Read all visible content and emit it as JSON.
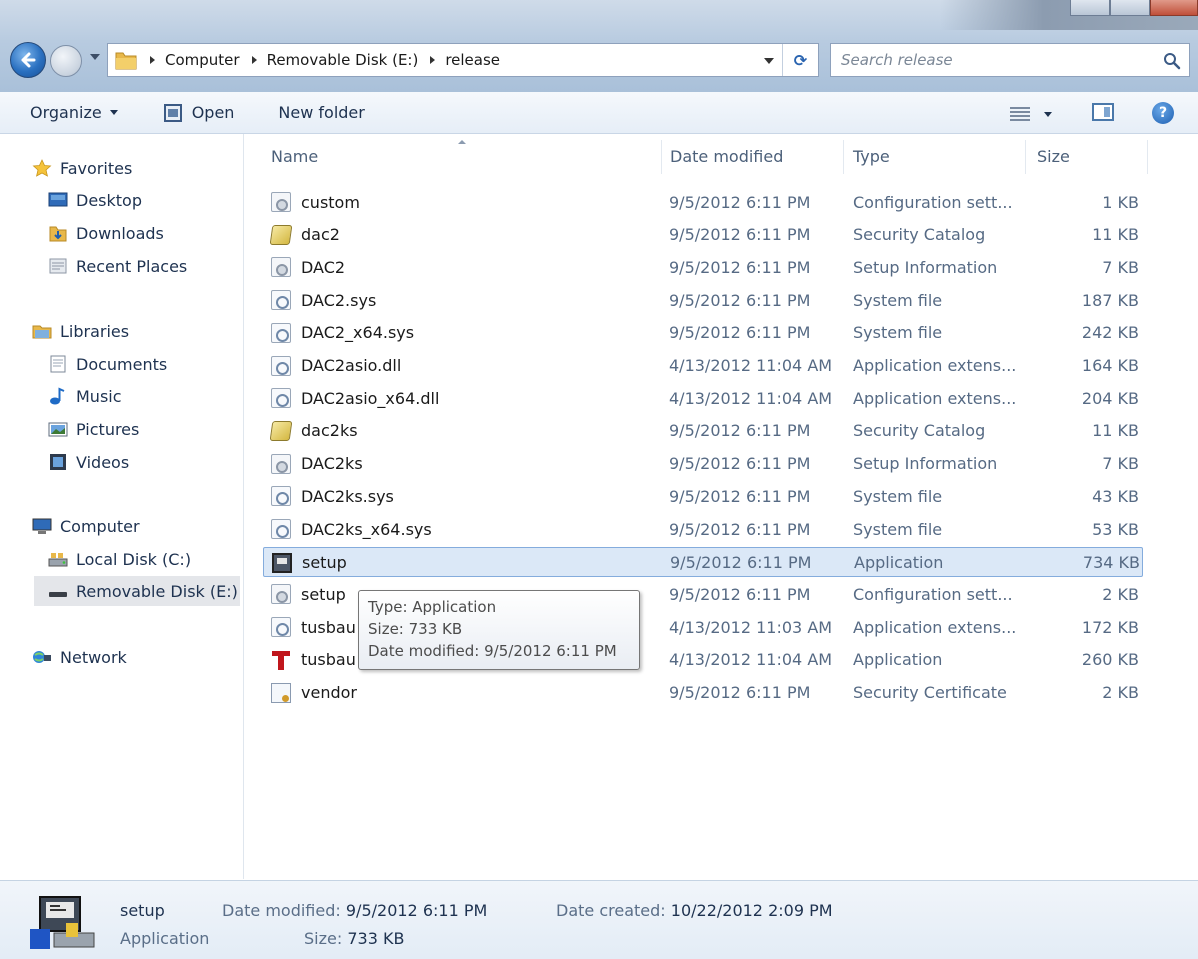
{
  "window": {
    "breadcrumb": [
      "Computer",
      "Removable Disk (E:)",
      "release"
    ],
    "search_placeholder": "Search release"
  },
  "toolbar": {
    "organize_label": "Organize",
    "open_label": "Open",
    "new_folder_label": "New folder"
  },
  "nav": {
    "favorites": "Favorites",
    "desktop": "Desktop",
    "downloads": "Downloads",
    "recent_places": "Recent Places",
    "libraries": "Libraries",
    "documents": "Documents",
    "music": "Music",
    "pictures": "Pictures",
    "videos": "Videos",
    "computer": "Computer",
    "local_disk": "Local Disk (C:)",
    "removable_disk": "Removable Disk (E:)",
    "network": "Network"
  },
  "columns": {
    "name": "Name",
    "date": "Date modified",
    "type": "Type",
    "size": "Size"
  },
  "files": [
    {
      "name": "custom",
      "date": "9/5/2012 6:11 PM",
      "type": "Configuration sett...",
      "size": "1 KB",
      "icon": "config-icon"
    },
    {
      "name": "dac2",
      "date": "9/5/2012 6:11 PM",
      "type": "Security Catalog",
      "size": "11 KB",
      "icon": "catalog-icon"
    },
    {
      "name": "DAC2",
      "date": "9/5/2012 6:11 PM",
      "type": "Setup Information",
      "size": "7 KB",
      "icon": "config-icon"
    },
    {
      "name": "DAC2.sys",
      "date": "9/5/2012 6:11 PM",
      "type": "System file",
      "size": "187 KB",
      "icon": "system-file-icon"
    },
    {
      "name": "DAC2_x64.sys",
      "date": "9/5/2012 6:11 PM",
      "type": "System file",
      "size": "242 KB",
      "icon": "system-file-icon"
    },
    {
      "name": "DAC2asio.dll",
      "date": "4/13/2012 11:04 AM",
      "type": "Application extens...",
      "size": "164 KB",
      "icon": "system-file-icon"
    },
    {
      "name": "DAC2asio_x64.dll",
      "date": "4/13/2012 11:04 AM",
      "type": "Application extens...",
      "size": "204 KB",
      "icon": "system-file-icon"
    },
    {
      "name": "dac2ks",
      "date": "9/5/2012 6:11 PM",
      "type": "Security Catalog",
      "size": "11 KB",
      "icon": "catalog-icon"
    },
    {
      "name": "DAC2ks",
      "date": "9/5/2012 6:11 PM",
      "type": "Setup Information",
      "size": "7 KB",
      "icon": "config-icon"
    },
    {
      "name": "DAC2ks.sys",
      "date": "9/5/2012 6:11 PM",
      "type": "System file",
      "size": "43 KB",
      "icon": "system-file-icon"
    },
    {
      "name": "DAC2ks_x64.sys",
      "date": "9/5/2012 6:11 PM",
      "type": "System file",
      "size": "53 KB",
      "icon": "system-file-icon"
    },
    {
      "name": "setup",
      "date": "9/5/2012 6:11 PM",
      "type": "Application",
      "size": "734 KB",
      "icon": "application-icon",
      "selected": true
    },
    {
      "name": "setup",
      "date": "9/5/2012 6:11 PM",
      "type": "Configuration sett...",
      "size": "2 KB",
      "icon": "config-icon"
    },
    {
      "name": "tusbau",
      "date": "4/13/2012 11:03 AM",
      "type": "Application extens...",
      "size": "172 KB",
      "icon": "system-file-icon"
    },
    {
      "name": "tusbau",
      "date": "4/13/2012 11:04 AM",
      "type": "Application",
      "size": "260 KB",
      "icon": "tusb-app-icon"
    },
    {
      "name": "vendor",
      "date": "9/5/2012 6:11 PM",
      "type": "Security Certificate",
      "size": "2 KB",
      "icon": "certificate-icon"
    }
  ],
  "tooltip": {
    "type_line": "Type: Application",
    "size_line": "Size: 733 KB",
    "date_line": "Date modified: 9/5/2012 6:11 PM"
  },
  "details": {
    "name": "setup",
    "type": "Application",
    "date_modified_label": "Date modified:",
    "date_modified": "9/5/2012 6:11 PM",
    "size_label": "Size:",
    "size": "733 KB",
    "date_created_label": "Date created:",
    "date_created": "10/22/2012 2:09 PM"
  },
  "colors": {
    "selection_bg": "#dbe8f7",
    "selection_border": "#84acdd",
    "accent": "#1e3250"
  }
}
